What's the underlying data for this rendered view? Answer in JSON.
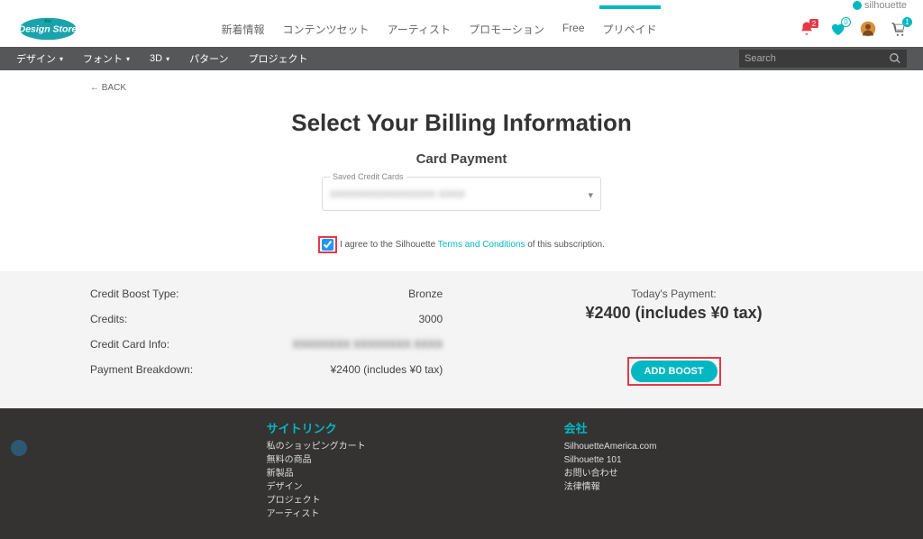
{
  "brand": "silhouette",
  "nav": {
    "items": [
      "新着情報",
      "コンテンツセット",
      "アーティスト",
      "プロモーション",
      "Free",
      "プリペイド"
    ],
    "active_index": 5
  },
  "icons": {
    "bell_badge": "2",
    "heart_badge": "0",
    "cart_badge": "1"
  },
  "subnav": {
    "items": [
      {
        "label": "デザイン",
        "caret": true
      },
      {
        "label": "フォント",
        "caret": true
      },
      {
        "label": "3D",
        "caret": true
      },
      {
        "label": "パターン",
        "caret": false
      },
      {
        "label": "プロジェクト",
        "caret": false
      }
    ],
    "search_placeholder": "Search"
  },
  "page": {
    "back": "← BACK",
    "title": "Select Your Billing Information",
    "subtitle": "Card Payment",
    "saved_cards_legend": "Saved Credit Cards",
    "saved_cards_value": "XXXXXXXXXXXXXXXX  XXXX",
    "agree_prefix": "I agree to the Silhouette ",
    "agree_link": "Terms and Conditions",
    "agree_suffix": " of this subscription."
  },
  "summary": {
    "rows": [
      {
        "k": "Credit Boost Type:",
        "v": "Bronze"
      },
      {
        "k": "Credits:",
        "v": "3000"
      },
      {
        "k": "Credit Card Info:",
        "v": "XXXXXXXX   XXXXXXXX   XXXX",
        "masked": true
      },
      {
        "k": "Payment Breakdown:",
        "v": "¥2400 (includes ¥0 tax)"
      }
    ],
    "today_label": "Today's Payment:",
    "today_amount": "¥2400 (includes ¥0 tax)",
    "boost_button": "ADD BOOST"
  },
  "footer": {
    "left_title": "サイトリンク",
    "left_items": [
      "私のショッピングカート",
      "無料の商品",
      "新製品",
      "デザイン",
      "プロジェクト",
      "アーティスト"
    ],
    "right_title": "会社",
    "right_items": [
      "SilhouetteAmerica.com",
      "Silhouette 101",
      "お問い合わせ",
      "法律情報"
    ]
  }
}
